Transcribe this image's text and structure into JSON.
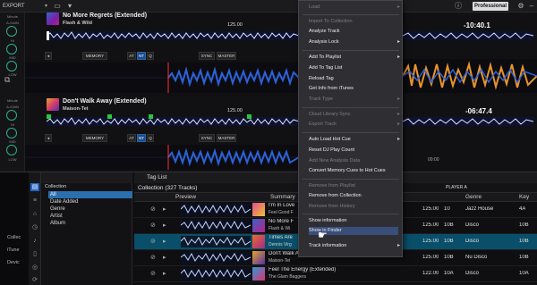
{
  "topbar": {
    "export_label": "EXPORT",
    "mode_label": "Professional"
  },
  "deck_left": {
    "labels": [
      "Minute",
      "A-GAIN",
      "HI",
      "MID",
      "LOW",
      "CUE"
    ],
    "labels2": [
      "Minute",
      "A-GAIN",
      "HI",
      "MID",
      "LOW",
      "CUE"
    ]
  },
  "deck1": {
    "title": "No More Regrets (Extended)",
    "artist": "Flash & Wild",
    "bpm": "125.00",
    "bpm_unit": "BPM",
    "time": "-10:40.1",
    "time_extra": "00:00",
    "memory": "MEMORY",
    "btn_at": "AT",
    "btn_nt": "NT",
    "btn_q": "Q",
    "btn_sync": "SYNC",
    "btn_master": "MASTER"
  },
  "deck2": {
    "title": "Don't Walk Away (Extended)",
    "artist": "Maison-Tet",
    "bpm": "125.00",
    "time": "-06:47.4",
    "time_extra": "00:00",
    "memory": "MEMORY",
    "btn_at": "AT",
    "btn_nt": "NT",
    "btn_q": "Q",
    "btn_sync": "SYNC",
    "btn_master": "MASTER"
  },
  "browser": {
    "far_left": [
      "Collec",
      "iTune",
      "Devic"
    ],
    "tree": {
      "header": "Collection",
      "items": [
        "All",
        "Date Added",
        "Genre",
        "Artist",
        "Album"
      ]
    },
    "list": {
      "tab_title": "Tag List",
      "collection_title": "Collection (327 Tracks)",
      "player_select": "PLAYER A",
      "columns": [
        "Preview",
        "Summary",
        "Genre",
        "Key"
      ],
      "rows": [
        {
          "title": "I'm In Love",
          "artist": "Feel Good F",
          "bpm": "125.00",
          "rating": "10",
          "genre": "Jazz House",
          "key": "4A"
        },
        {
          "title": "No More F",
          "artist": "Flash & Wi",
          "bpm": "125.00",
          "rating": "10B",
          "genre": "Disco",
          "key": "10B"
        },
        {
          "title": "Times Are",
          "artist": "Dennis Virg",
          "bpm": "125.00",
          "rating": "10B",
          "genre": "Disco",
          "key": "10B"
        },
        {
          "title": "Don't Walk Away (Extended)",
          "artist": "Maison-Tet",
          "bpm": "125.00",
          "rating": "10B",
          "genre": "Nu Disco",
          "key": "10B"
        },
        {
          "title": "Feel The Energy (Extended)",
          "artist": "The Glam Baggers",
          "bpm": "122.00",
          "rating": "10A",
          "genre": "Disco",
          "key": "10A"
        }
      ]
    }
  },
  "context_menu": {
    "items": [
      {
        "label": "Load",
        "disabled": true,
        "submenu": true
      },
      {
        "label": "Import To Collection",
        "disabled": true,
        "submenu": false
      },
      {
        "label": "Analyze Track",
        "disabled": false,
        "submenu": false
      },
      {
        "label": "Analysis Lock",
        "disabled": false,
        "submenu": true
      },
      {
        "label": "Add To Playlist",
        "disabled": false,
        "submenu": true
      },
      {
        "label": "Add To Tag List",
        "disabled": false,
        "submenu": false
      },
      {
        "label": "Reload Tag",
        "disabled": false,
        "submenu": false
      },
      {
        "label": "Get Info from iTunes",
        "disabled": false,
        "submenu": false
      },
      {
        "label": "Track Type",
        "disabled": true,
        "submenu": true
      },
      {
        "label": "Cloud Library Sync",
        "disabled": true,
        "submenu": true
      },
      {
        "label": "Export Track",
        "disabled": true,
        "submenu": true
      },
      {
        "label": "Auto Load Hot Cue",
        "disabled": false,
        "submenu": true
      },
      {
        "label": "Reset DJ Play Count",
        "disabled": false,
        "submenu": false
      },
      {
        "label": "Add New Analysis Data",
        "disabled": true,
        "submenu": false
      },
      {
        "label": "Convert Memory Cues to Hot Cues",
        "disabled": false,
        "submenu": false
      },
      {
        "label": "Remove from Playlist",
        "disabled": true,
        "submenu": false
      },
      {
        "label": "Remove from Collection",
        "disabled": false,
        "submenu": false
      },
      {
        "label": "Remove from History",
        "disabled": true,
        "submenu": false
      },
      {
        "label": "Show information",
        "disabled": false,
        "submenu": false
      },
      {
        "label": "Show in Finder",
        "disabled": false,
        "submenu": false
      },
      {
        "label": "Track information",
        "disabled": false,
        "submenu": true
      }
    ]
  },
  "colors": {
    "accent_blue": "#2564c8",
    "selection": "#0a4f6a",
    "hotcue_green": "#28c83c",
    "wave_blue": "#2d62d8",
    "wave_orange": "#e8942a"
  }
}
